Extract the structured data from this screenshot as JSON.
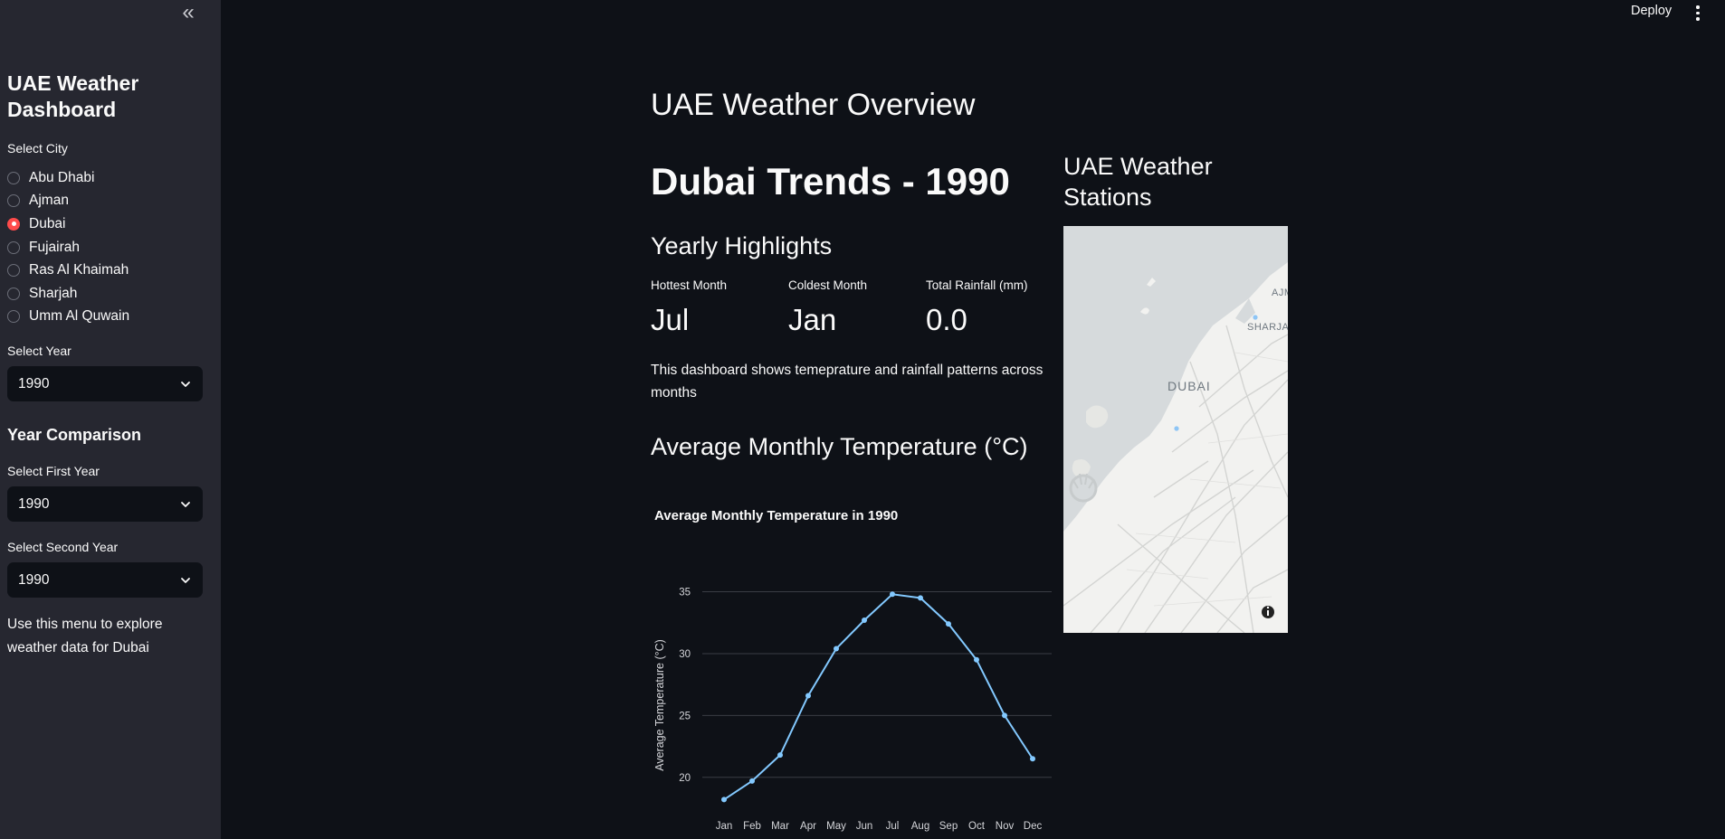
{
  "sidebar": {
    "collapse_icon": "chevrons-left-icon",
    "title": "UAE Weather Dashboard",
    "city_label": "Select City",
    "cities": [
      "Abu Dhabi",
      "Ajman",
      "Dubai",
      "Fujairah",
      "Ras Al Khaimah",
      "Sharjah",
      "Umm Al Quwain"
    ],
    "selected_city": "Dubai",
    "year_label": "Select Year",
    "year_value": "1990",
    "comparison_title": "Year Comparison",
    "first_year_label": "Select First Year",
    "first_year_value": "1990",
    "second_year_label": "Select Second Year",
    "second_year_value": "1990",
    "note": "Use this menu to explore weather data for Dubai"
  },
  "toolbar": {
    "deploy_label": "Deploy",
    "menu_icon": "kebab-menu-icon"
  },
  "main": {
    "page_title": "UAE Weather Overview",
    "trend_title": "Dubai Trends - 1990",
    "highlights_title": "Yearly Highlights",
    "metrics": [
      {
        "label": "Hottest Month",
        "value": "Jul"
      },
      {
        "label": "Coldest Month",
        "value": "Jan"
      },
      {
        "label": "Total Rainfall (mm)",
        "value": "0.0"
      }
    ],
    "description": "This dashboard shows temeprature and rainfall patterns across months",
    "temp_section_title": "Average Monthly Temperature (°C)"
  },
  "map": {
    "title": "UAE Weather Stations",
    "labels": [
      "DUBAI",
      "SHARJA",
      "AJM"
    ],
    "info_icon": "info-icon",
    "colors": {
      "land": "#f2f2f0",
      "water": "#d6dadc",
      "road": "#d3d4d2",
      "marker": "#8ec5f5"
    }
  },
  "chart_data": {
    "type": "line",
    "title": "Average Monthly Temperature in 1990",
    "xlabel": "",
    "ylabel": "Average Temperature (°C)",
    "categories": [
      "Jan",
      "Feb",
      "Mar",
      "Apr",
      "May",
      "Jun",
      "Jul",
      "Aug",
      "Sep",
      "Oct",
      "Nov",
      "Dec"
    ],
    "values": [
      18.2,
      19.7,
      21.8,
      26.6,
      30.4,
      32.7,
      34.8,
      34.5,
      32.4,
      29.5,
      25.0,
      21.5
    ],
    "yticks": [
      20,
      25,
      30,
      35
    ],
    "ylim": [
      17.5,
      36.5
    ],
    "grid": true,
    "color": "#83c9ff"
  }
}
